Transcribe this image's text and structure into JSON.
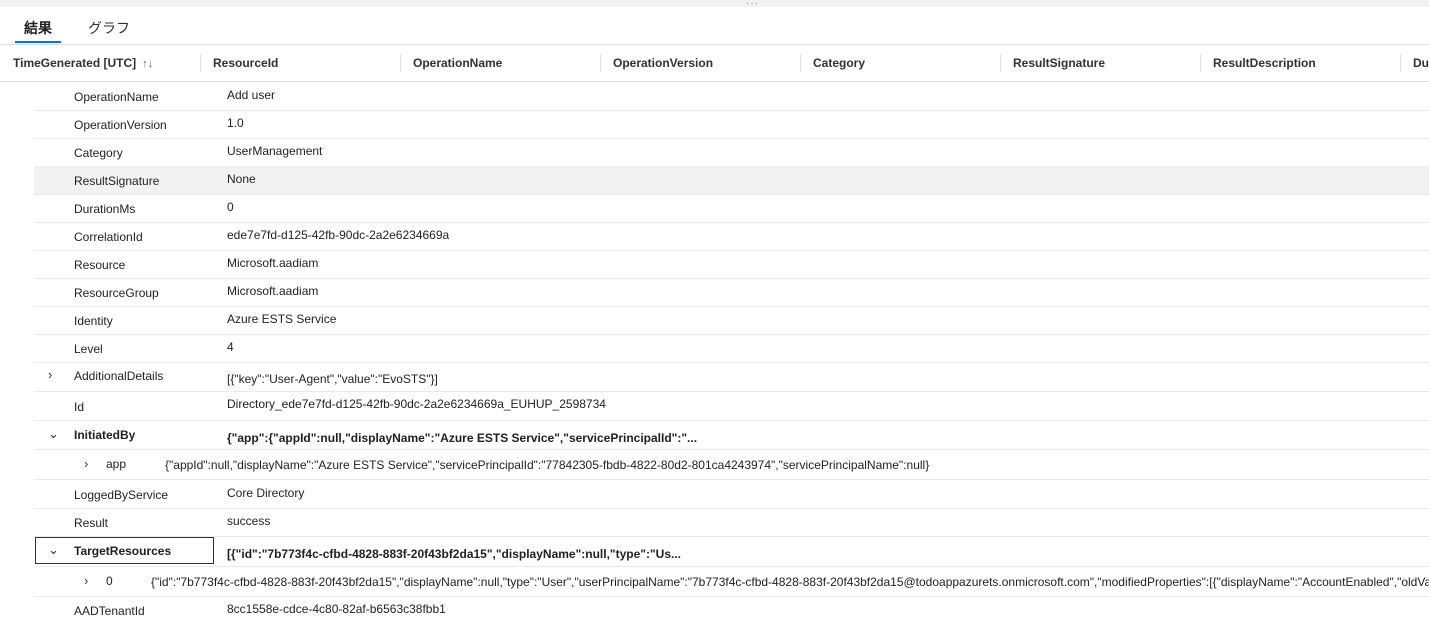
{
  "tabs": [
    {
      "label": "結果"
    },
    {
      "label": "グラフ"
    }
  ],
  "columns": [
    {
      "label": "TimeGenerated [UTC]",
      "sort": "↑↓"
    },
    {
      "label": "ResourceId"
    },
    {
      "label": "OperationName"
    },
    {
      "label": "OperationVersion"
    },
    {
      "label": "Category"
    },
    {
      "label": "ResultSignature"
    },
    {
      "label": "ResultDescription"
    },
    {
      "label": "Du"
    }
  ],
  "rows": [
    {
      "key": "OperationName",
      "value": "Add user"
    },
    {
      "key": "OperationVersion",
      "value": "1.0"
    },
    {
      "key": "Category",
      "value": "UserManagement"
    },
    {
      "key": "ResultSignature",
      "value": "None"
    },
    {
      "key": "DurationMs",
      "value": "0"
    },
    {
      "key": "CorrelationId",
      "value": "ede7e7fd-d125-42fb-90dc-2a2e6234669a"
    },
    {
      "key": "Resource",
      "value": "Microsoft.aadiam"
    },
    {
      "key": "ResourceGroup",
      "value": "Microsoft.aadiam"
    },
    {
      "key": "Identity",
      "value": "Azure ESTS Service"
    },
    {
      "key": "Level",
      "value": "4"
    },
    {
      "key": "AdditionalDetails",
      "value": "[{\"key\":\"User-Agent\",\"value\":\"EvoSTS\"}]"
    },
    {
      "key": "Id",
      "value": "Directory_ede7e7fd-d125-42fb-90dc-2a2e6234669a_EUHUP_2598734"
    },
    {
      "key": "InitiatedBy",
      "value": "{\"app\":{\"appId\":null,\"displayName\":\"Azure ESTS Service\",\"servicePrincipalId\":\"..."
    },
    {
      "key": "app",
      "value": "{\"appId\":null,\"displayName\":\"Azure ESTS Service\",\"servicePrincipalId\":\"77842305-fbdb-4822-80d2-801ca4243974\",\"servicePrincipalName\":null}"
    },
    {
      "key": "LoggedByService",
      "value": "Core Directory"
    },
    {
      "key": "Result",
      "value": "success"
    },
    {
      "key": "TargetResources",
      "value": "[{\"id\":\"7b773f4c-cfbd-4828-883f-20f43bf2da15\",\"displayName\":null,\"type\":\"Us..."
    },
    {
      "key": "0",
      "value": "{\"id\":\"7b773f4c-cfbd-4828-883f-20f43bf2da15\",\"displayName\":null,\"type\":\"User\",\"userPrincipalName\":\"7b773f4c-cfbd-4828-883f-20f43bf2da15@todoappazurets.onmicrosoft.com\",\"modifiedProperties\":[{\"displayName\":\"AccountEnabled\",\"oldVa"
    },
    {
      "key": "AADTenantId",
      "value": "8cc1558e-cdce-4c80-82af-b6563c38fbb1"
    }
  ],
  "icons": {
    "collapsed": "chevron-right-icon",
    "expanded": "chevron-down-icon",
    "grip": "drag-handle-icon"
  }
}
